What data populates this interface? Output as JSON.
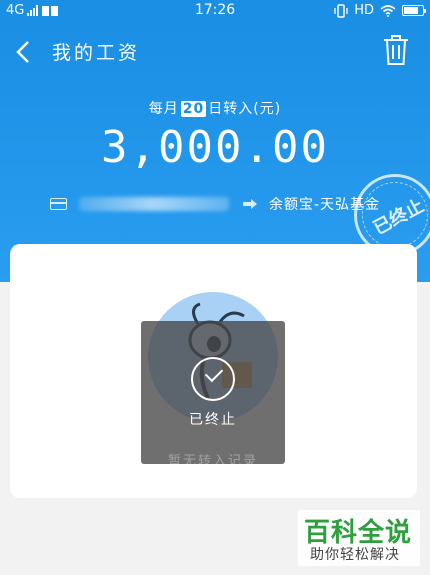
{
  "status_bar": {
    "network": "4G",
    "time": "17:26",
    "hd": "HD"
  },
  "header": {
    "title": "我的工资"
  },
  "plan": {
    "schedule_prefix": "每月",
    "day": "20",
    "schedule_suffix": "日转入(元)",
    "amount": "3,000.00",
    "destination": "余额宝-天弘基金",
    "stamp": "已终止"
  },
  "toast": {
    "text": "已终止"
  },
  "records": {
    "empty_text": "暂无转入记录"
  },
  "watermark": {
    "title": "百科全说",
    "subtitle": "助你轻松解决"
  }
}
